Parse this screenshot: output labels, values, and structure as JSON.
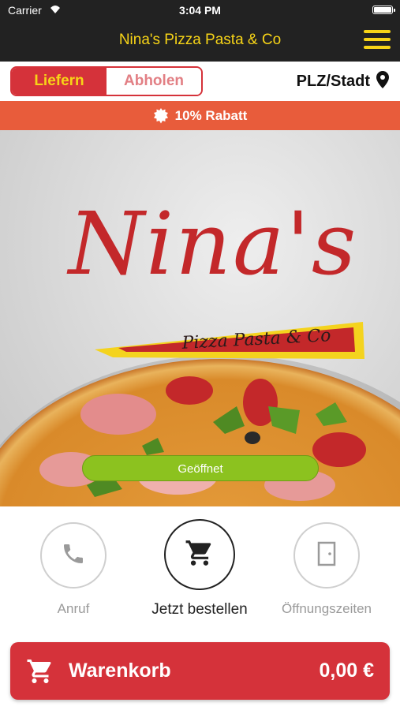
{
  "status_bar": {
    "carrier": "Carrier",
    "time": "3:04 PM"
  },
  "nav": {
    "title": "Nina's Pizza Pasta & Co",
    "menu_icon": "hamburger-icon"
  },
  "order_mode": {
    "deliver_label": "Liefern",
    "pickup_label": "Abholen",
    "selected": "Liefern"
  },
  "location": {
    "label": "PLZ/Stadt",
    "icon": "map-pin-icon"
  },
  "discount": {
    "text": "10% Rabatt",
    "icon": "badge-icon"
  },
  "hero": {
    "logo_text": "Nina's",
    "logo_subtitle": "Pizza Pasta & Co",
    "status": "Geöffnet"
  },
  "actions": [
    {
      "label": "Anruf",
      "icon": "phone-icon"
    },
    {
      "label": "Jetzt bestellen",
      "icon": "cart-icon"
    },
    {
      "label": "Öffnungszeiten",
      "icon": "door-icon"
    }
  ],
  "cart": {
    "label": "Warenkorb",
    "total": "0,00 €",
    "icon": "cart-icon"
  },
  "colors": {
    "brand_red": "#d5323a",
    "accent_yellow": "#f7d417",
    "banner_orange": "#e85c3b",
    "open_green": "#8cc21f",
    "dark_bar": "#222222"
  }
}
